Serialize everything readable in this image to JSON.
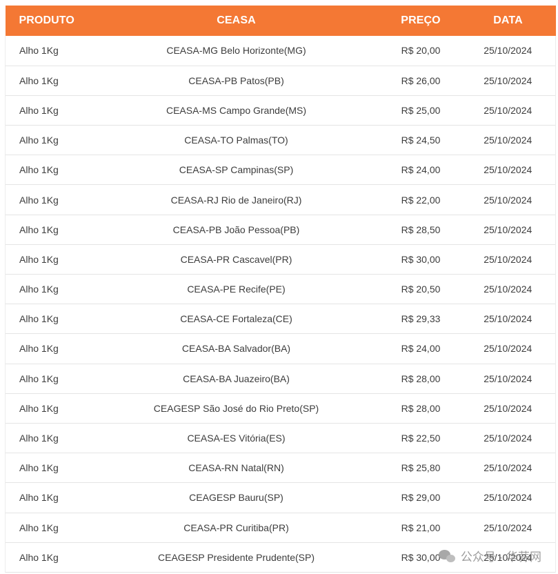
{
  "table": {
    "headers": {
      "produto": "PRODUTO",
      "ceasa": "CEASA",
      "preco": "PREÇO",
      "data": "DATA"
    },
    "rows": [
      {
        "produto": "Alho 1Kg",
        "ceasa": "CEASA-MG Belo Horizonte(MG)",
        "preco": "R$ 20,00",
        "data": "25/10/2024"
      },
      {
        "produto": "Alho 1Kg",
        "ceasa": "CEASA-PB Patos(PB)",
        "preco": "R$ 26,00",
        "data": "25/10/2024"
      },
      {
        "produto": "Alho 1Kg",
        "ceasa": "CEASA-MS Campo Grande(MS)",
        "preco": "R$ 25,00",
        "data": "25/10/2024"
      },
      {
        "produto": "Alho 1Kg",
        "ceasa": "CEASA-TO Palmas(TO)",
        "preco": "R$ 24,50",
        "data": "25/10/2024"
      },
      {
        "produto": "Alho 1Kg",
        "ceasa": "CEASA-SP Campinas(SP)",
        "preco": "R$ 24,00",
        "data": "25/10/2024"
      },
      {
        "produto": "Alho 1Kg",
        "ceasa": "CEASA-RJ Rio de Janeiro(RJ)",
        "preco": "R$ 22,00",
        "data": "25/10/2024"
      },
      {
        "produto": "Alho 1Kg",
        "ceasa": "CEASA-PB João Pessoa(PB)",
        "preco": "R$ 28,50",
        "data": "25/10/2024"
      },
      {
        "produto": "Alho 1Kg",
        "ceasa": "CEASA-PR Cascavel(PR)",
        "preco": "R$ 30,00",
        "data": "25/10/2024"
      },
      {
        "produto": "Alho 1Kg",
        "ceasa": "CEASA-PE Recife(PE)",
        "preco": "R$ 20,50",
        "data": "25/10/2024"
      },
      {
        "produto": "Alho 1Kg",
        "ceasa": "CEASA-CE Fortaleza(CE)",
        "preco": "R$ 29,33",
        "data": "25/10/2024"
      },
      {
        "produto": "Alho 1Kg",
        "ceasa": "CEASA-BA Salvador(BA)",
        "preco": "R$ 24,00",
        "data": "25/10/2024"
      },
      {
        "produto": "Alho 1Kg",
        "ceasa": "CEASA-BA Juazeiro(BA)",
        "preco": "R$ 28,00",
        "data": "25/10/2024"
      },
      {
        "produto": "Alho 1Kg",
        "ceasa": "CEAGESP São José do Rio Preto(SP)",
        "preco": "R$ 28,00",
        "data": "25/10/2024"
      },
      {
        "produto": "Alho 1Kg",
        "ceasa": "CEASA-ES Vitória(ES)",
        "preco": "R$ 22,50",
        "data": "25/10/2024"
      },
      {
        "produto": "Alho 1Kg",
        "ceasa": "CEASA-RN Natal(RN)",
        "preco": "R$ 25,80",
        "data": "25/10/2024"
      },
      {
        "produto": "Alho 1Kg",
        "ceasa": "CEAGESP Bauru(SP)",
        "preco": "R$ 29,00",
        "data": "25/10/2024"
      },
      {
        "produto": "Alho 1Kg",
        "ceasa": "CEASA-PR Curitiba(PR)",
        "preco": "R$ 21,00",
        "data": "25/10/2024"
      },
      {
        "produto": "Alho 1Kg",
        "ceasa": "CEAGESP Presidente Prudente(SP)",
        "preco": "R$ 30,00",
        "data": "25/10/2024"
      }
    ]
  },
  "watermark": {
    "text": "公众号 · 华蒜网",
    "icon": "wechat-icon"
  },
  "colors": {
    "header_bg": "#f47834",
    "header_text": "#ffffff",
    "row_border": "#e4e4e4"
  }
}
